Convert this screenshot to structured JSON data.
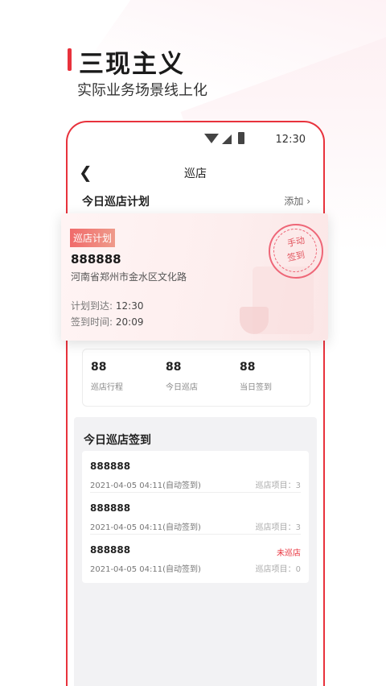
{
  "header": {
    "title": "三现主义",
    "subtitle": "实际业务场景线上化"
  },
  "statusbar": {
    "time": "12:30"
  },
  "nav": {
    "back_icon": "chevron-left-icon",
    "title": "巡店"
  },
  "plan": {
    "title": "今日巡店计划",
    "add_label": "添加 ›"
  },
  "card": {
    "badge": "巡店计划",
    "name": "888888",
    "address": "河南省郑州市金水区文化路",
    "arrive_label": "计划到达:",
    "arrive_time": "12:30",
    "signin_label": "签到时间:",
    "signin_time": "20:09",
    "stamp_line1": "手动",
    "stamp_line2": "签到"
  },
  "stats": [
    {
      "value": "88",
      "label": "巡店行程"
    },
    {
      "value": "88",
      "label": "今日巡店"
    },
    {
      "value": "88",
      "label": "当日签到"
    }
  ],
  "signin": {
    "title": "今日巡店签到",
    "rows": [
      {
        "name": "888888",
        "time": "2021-04-05 04:11(自动签到)",
        "status": "",
        "count": "巡店项目：3"
      },
      {
        "name": "888888",
        "time": "2021-04-05 04:11(自动签到)",
        "status": "",
        "count": "巡店项目：3"
      },
      {
        "name": "888888",
        "time": "2021-04-05 04:11(自动签到)",
        "status": "未巡店",
        "count": "巡店项目：0"
      }
    ]
  },
  "colors": {
    "accent": "#e8323c"
  }
}
